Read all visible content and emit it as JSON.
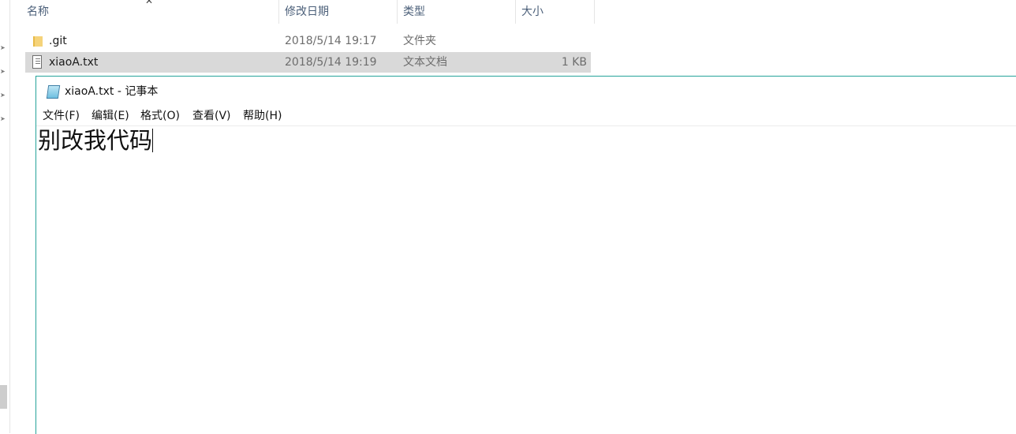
{
  "explorer": {
    "columns": {
      "name": "名称",
      "modified": "修改日期",
      "type": "类型",
      "size": "大小"
    },
    "files": [
      {
        "icon": "folder-icon",
        "name": ".git",
        "modified": "2018/5/14 19:17",
        "type": "文件夹",
        "size": ""
      },
      {
        "icon": "text-file-icon",
        "name": "xiaoA.txt",
        "modified": "2018/5/14 19:19",
        "type": "文本文档",
        "size": "1 KB"
      }
    ],
    "selected_row": "xiaoA.txt"
  },
  "notepad": {
    "title": "xiaoA.txt - 记事本",
    "menu": [
      "文件(F)",
      "编辑(E)",
      "格式(O)",
      "查看(V)",
      "帮助(H)"
    ],
    "content": "别改我代码",
    "accent_color": "#25a39a"
  }
}
